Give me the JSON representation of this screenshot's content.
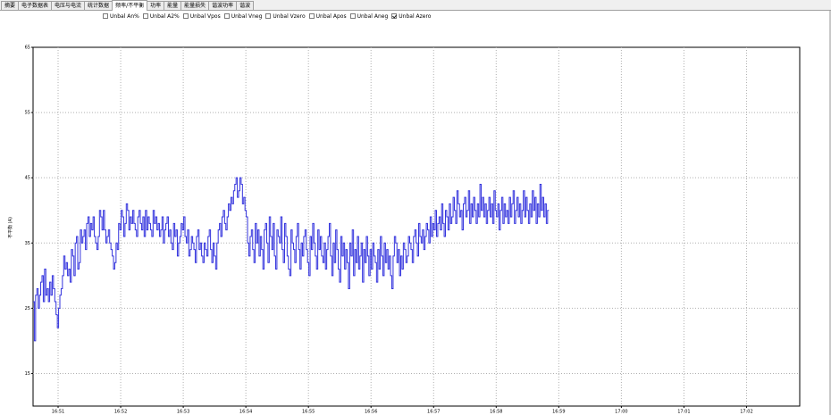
{
  "tabs": [
    {
      "label": "摘要",
      "active": false
    },
    {
      "label": "电子数据表",
      "active": false
    },
    {
      "label": "电压与电流",
      "active": false
    },
    {
      "label": "统计数据",
      "active": false
    },
    {
      "label": "频率/不平衡",
      "active": true
    },
    {
      "label": "功率",
      "active": false
    },
    {
      "label": "能量",
      "active": false
    },
    {
      "label": "能量损失",
      "active": false
    },
    {
      "label": "谐波功率",
      "active": false
    },
    {
      "label": "谐波",
      "active": false
    }
  ],
  "checkboxes": [
    {
      "label": "Unbal An%",
      "checked": false
    },
    {
      "label": "Unbal A2%",
      "checked": false
    },
    {
      "label": "Unbal Vpos",
      "checked": false
    },
    {
      "label": "Unbal Vneg",
      "checked": false
    },
    {
      "label": "Unbal Vzero",
      "checked": false
    },
    {
      "label": "Unbal Apos",
      "checked": false
    },
    {
      "label": "Unbal Aneg",
      "checked": false
    },
    {
      "label": "Unbal Azero",
      "checked": true
    }
  ],
  "chart_data": {
    "type": "line",
    "ylabel": "不平衡 (A)",
    "ylim": [
      10,
      65
    ],
    "y_ticks": [
      {
        "value": 15,
        "label": "15"
      },
      {
        "value": 25,
        "label": "25"
      },
      {
        "value": 35,
        "label": "35"
      },
      {
        "value": 45,
        "label": "45"
      },
      {
        "value": 55,
        "label": "55"
      },
      {
        "value": 65,
        "label": "65"
      }
    ],
    "xlim": [
      0,
      12.25
    ],
    "x_ticks": [
      {
        "value": 0.4,
        "label": "16:51"
      },
      {
        "value": 1.4,
        "label": "16:52"
      },
      {
        "value": 2.4,
        "label": "16:53"
      },
      {
        "value": 3.4,
        "label": "16:54"
      },
      {
        "value": 4.4,
        "label": "16:55"
      },
      {
        "value": 5.4,
        "label": "16:56"
      },
      {
        "value": 6.4,
        "label": "16:57"
      },
      {
        "value": 7.4,
        "label": "16:58"
      },
      {
        "value": 8.4,
        "label": "16:59"
      },
      {
        "value": 9.4,
        "label": "17:00"
      },
      {
        "value": 10.4,
        "label": "17:01"
      },
      {
        "value": 11.4,
        "label": "17:02"
      }
    ],
    "grid": true,
    "series": [
      {
        "name": "Unbal Azero",
        "color": "#3333dd",
        "x_start": 0,
        "x_step": 0.0204,
        "values": [
          26,
          20,
          27,
          28,
          25,
          27,
          29,
          30,
          26,
          31,
          27,
          28,
          26,
          29,
          27,
          30,
          28,
          26,
          24,
          22,
          25,
          27,
          28,
          30,
          33,
          31,
          32,
          30,
          31,
          29,
          34,
          33,
          30,
          35,
          36,
          31,
          32,
          37,
          35,
          36,
          37,
          34,
          38,
          39,
          36,
          38,
          37,
          39,
          36,
          35,
          34,
          36,
          40,
          39,
          37,
          40,
          37,
          35,
          36,
          37,
          35,
          34,
          33,
          31,
          32,
          35,
          34,
          38,
          37,
          40,
          39,
          36,
          38,
          41,
          40,
          37,
          39,
          38,
          40,
          38,
          37,
          36,
          39,
          40,
          38,
          37,
          39,
          36,
          40,
          37,
          39,
          38,
          37,
          36,
          40,
          38,
          39,
          37,
          38,
          36,
          37,
          39,
          35,
          37,
          38,
          39,
          36,
          37,
          35,
          34,
          38,
          36,
          37,
          33,
          35,
          36,
          38,
          37,
          39,
          36,
          35,
          37,
          33,
          34,
          36,
          35,
          34,
          32,
          36,
          37,
          34,
          35,
          33,
          32,
          35,
          34,
          33,
          36,
          37,
          34,
          32,
          35,
          33,
          31,
          35,
          37,
          38,
          36,
          39,
          40,
          38,
          37,
          39,
          41,
          40,
          42,
          41,
          43,
          44,
          45,
          42,
          43,
          45,
          44,
          41,
          42,
          40,
          39,
          35,
          33,
          36,
          37,
          34,
          32,
          38,
          35,
          37,
          33,
          36,
          34,
          31,
          37,
          38,
          35,
          32,
          39,
          36,
          34,
          38,
          33,
          31,
          37,
          36,
          35,
          39,
          34,
          32,
          38,
          36,
          33,
          31,
          30,
          37,
          35,
          34,
          32,
          36,
          38,
          34,
          31,
          35,
          33,
          36,
          37,
          34,
          32,
          30,
          36,
          34,
          38,
          35,
          33,
          31,
          37,
          34,
          36,
          33,
          32,
          35,
          31,
          34,
          36,
          38,
          33,
          30,
          35,
          32,
          37,
          34,
          31,
          29,
          36,
          33,
          35,
          31,
          34,
          32,
          28,
          35,
          33,
          37,
          30,
          34,
          32,
          36,
          31,
          33,
          35,
          29,
          34,
          32,
          36,
          33,
          30,
          34,
          31,
          35,
          33,
          32,
          29,
          34,
          31,
          36,
          33,
          30,
          35,
          32,
          34,
          31,
          33,
          30,
          28,
          33,
          36,
          35,
          32,
          34,
          30,
          33,
          31,
          35,
          34,
          32,
          33,
          36,
          35,
          34,
          32,
          36,
          37,
          35,
          33,
          38,
          36,
          35,
          37,
          34,
          36,
          38,
          37,
          35,
          39,
          36,
          38,
          37,
          40,
          36,
          38,
          39,
          37,
          41,
          38,
          36,
          40,
          39,
          37,
          41,
          38,
          39,
          42,
          40,
          38,
          43,
          41,
          39,
          40,
          37,
          41,
          42,
          39,
          40,
          43,
          38,
          41,
          39,
          42,
          40,
          38,
          41,
          39,
          44,
          40,
          42,
          39,
          41,
          38,
          40,
          42,
          39,
          41,
          38,
          43,
          40,
          39,
          41,
          37,
          40,
          42,
          38,
          41,
          39,
          40,
          38,
          42,
          39,
          41,
          43,
          38,
          40,
          42,
          39,
          41,
          38,
          40,
          43,
          39,
          42,
          40,
          38,
          41,
          39,
          43,
          40,
          42,
          38,
          41,
          39,
          44,
          40,
          42,
          39,
          41,
          38,
          40
        ]
      }
    ]
  }
}
